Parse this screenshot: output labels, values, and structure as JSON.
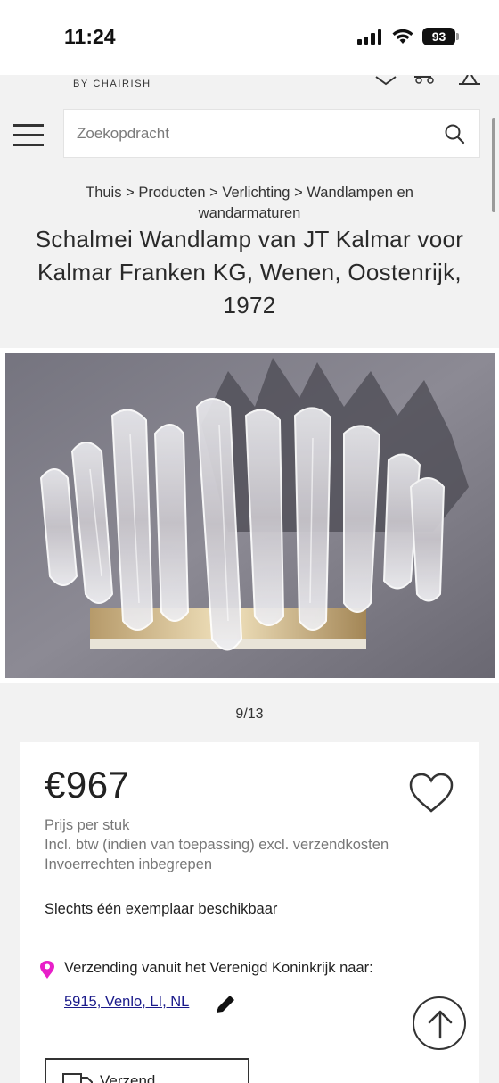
{
  "status_bar": {
    "time": "11:24",
    "battery": "93"
  },
  "header": {
    "brand_tagline": "BY CHAIRISH",
    "search_placeholder": "Zoekopdracht"
  },
  "breadcrumb": {
    "items": [
      "Thuis",
      "Producten",
      "Verlichting",
      "Wandlampen en wandarmaturen"
    ],
    "separator": ">"
  },
  "product": {
    "title": "Schalmei Wandlamp van JT Kalmar voor Kalmar Franken KG, Wenen, Oostenrijk, 1972",
    "image_counter": "9/13",
    "price": "€967",
    "price_unit": "Prijs per stuk",
    "tax_note": "Incl. btw (indien van toepassing) excl. verzendkosten",
    "duties_note": "Invoerrechten inbegrepen",
    "availability": "Slechts één exemplaar beschikbaar",
    "shipping_from": "Verzending vanuit het Verenigd Koninkrijk naar:",
    "shipping_location": "5915, Venlo, LI, NL",
    "shipping_button_label": "Verzend..."
  },
  "colors": {
    "accent_pin": "#e81fc9",
    "link": "#1a1a8a",
    "background": "#f2f2f2"
  },
  "icons": [
    "menu-icon",
    "search-icon",
    "heart-icon",
    "pin-icon",
    "pencil-icon",
    "truck-icon",
    "arrow-up-icon"
  ]
}
